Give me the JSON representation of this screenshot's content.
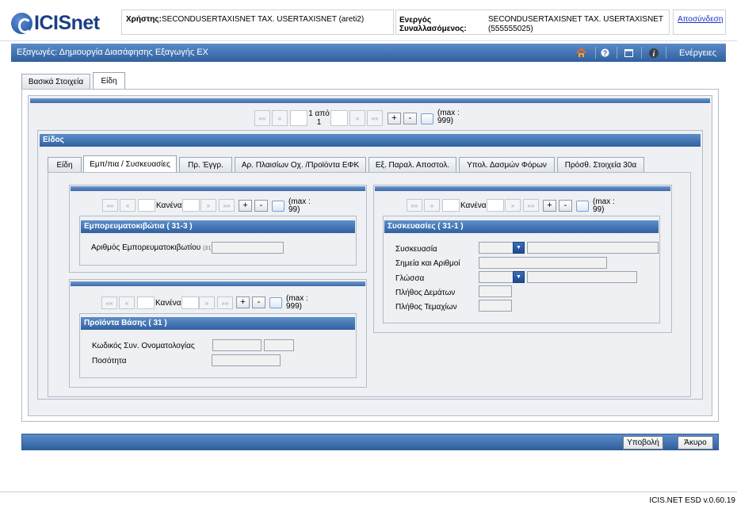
{
  "app": {
    "logo": "ICISnet"
  },
  "header": {
    "user_label": "Χρήστης:",
    "user_value": "SECONDUSERTAXISNET TAX. USERTAXISNET (areti2)",
    "active_label_1": "Ενεργός",
    "active_label_2": "Συναλλασόμενος:",
    "active_value_1": "SECONDUSERTAXISNET TAX. USERTAXISNET",
    "active_value_2": "(555555025)",
    "logout": "Αποσύνδεση"
  },
  "navbar": {
    "title": "Εξαγωγές: Δημιουργία Διασάφησης Εξαγωγής ΕΧ",
    "actions": "Ενέργειες",
    "icons": [
      "home-icon",
      "help-icon",
      "window-icon",
      "info-icon"
    ]
  },
  "main_tabs": [
    {
      "label": "Βασικά Στοιχεία"
    },
    {
      "label": "Είδη"
    }
  ],
  "pager_main": {
    "first": "««",
    "prev": "«",
    "page_text_1": "1 από",
    "page_text_2": "1",
    "next": "»",
    "last": "»»",
    "add": "+",
    "remove": "-",
    "max_1": "(max :",
    "max_2": "999)"
  },
  "item_section": {
    "title": "Είδος"
  },
  "sub_tabs": [
    {
      "label": "Είδη"
    },
    {
      "label": "Εμπ/πια / Συσκευασίες"
    },
    {
      "label": "Πρ. Έγγρ."
    },
    {
      "label": "Αρ. Πλαισίων Οχ. /Προϊόντα ΕΦΚ"
    },
    {
      "label": "Εξ. Παραλ. Αποστολ."
    },
    {
      "label": "Υπολ. Δασμών Φόρων"
    },
    {
      "label": "Πρόσθ. Στοιχεία 30α"
    }
  ],
  "containers": {
    "pager": {
      "first": "««",
      "prev": "«",
      "text": "Κανένα",
      "next": "»",
      "last": "»»",
      "add": "+",
      "remove": "-",
      "max_1": "(max :",
      "max_2": "99)"
    },
    "title": "Εμπορευματοκιβώτια ( 31-3 )",
    "field_label": "Αριθμός Εμπορευματοκιβωτίου",
    "field_code": "(31)",
    "field_value": ""
  },
  "base_products": {
    "pager": {
      "first": "««",
      "prev": "«",
      "text": "Κανένα",
      "next": "»",
      "last": "»»",
      "add": "+",
      "remove": "-",
      "max_1": "(max :",
      "max_2": "999)"
    },
    "title": "Προϊόντα Βάσης ( 31 )",
    "field1_label": "Κωδικός Συν. Ονοματολογίας",
    "field1_value_a": "",
    "field1_value_b": "",
    "field2_label": "Ποσότητα",
    "field2_value": ""
  },
  "packages": {
    "pager": {
      "first": "««",
      "prev": "«",
      "text": "Κανένα",
      "next": "»",
      "last": "»»",
      "add": "+",
      "remove": "-",
      "max_1": "(max :",
      "max_2": "99)"
    },
    "title": "Συσκευασίες ( 31-1 )",
    "fields": [
      {
        "label": "Συσκευασία",
        "value": ""
      },
      {
        "label": "Σημεία και Αριθμοί",
        "value": ""
      },
      {
        "label": "Γλώσσα",
        "value": ""
      },
      {
        "label": "Πλήθος Δεμάτων",
        "value": ""
      },
      {
        "label": "Πλήθος Τεμαχίων",
        "value": ""
      }
    ]
  },
  "actions": {
    "submit": "Υποβολή",
    "cancel": "Άκυρο"
  },
  "footer": {
    "version": "ICIS.NET ESD v.0.60.19"
  }
}
